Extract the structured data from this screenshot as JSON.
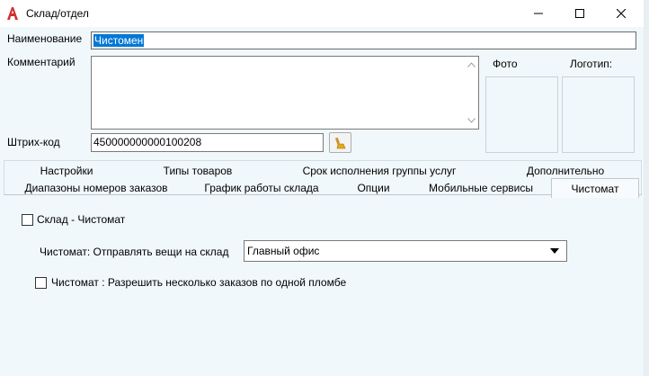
{
  "window": {
    "title": "Склад/отдел",
    "app_icon": "red-a-icon",
    "controls": [
      "minimize-icon",
      "maximize-icon",
      "close-icon"
    ]
  },
  "form": {
    "name_label": "Наименование",
    "name_value": "Чистомен",
    "comment_label": "Комментарий",
    "comment_value": "",
    "barcode_label": "Штрих-код",
    "barcode_value": "450000000000100208",
    "barcode_button_icon": "brush-icon",
    "photo_label": "Фото",
    "logo_label": "Логотип:"
  },
  "tabs": {
    "row1": [
      "Настройки",
      "Типы товаров",
      "Срок исполнения группы услуг",
      "Дополнительно"
    ],
    "row2": [
      "Диапазоны номеров заказов",
      "График работы склада",
      "Опции",
      "Мобильные сервисы",
      "Чистомат"
    ],
    "active": "Чистомат"
  },
  "panel": {
    "checkbox_warehouse_label": "Склад - Чистомат",
    "checkbox_warehouse_checked": false,
    "send_label": "Чистомат: Отправлять вещи на склад",
    "send_value": "Главный офис",
    "checkbox_multi_label": "Чистомат : Разрешить несколько заказов по одной пломбе",
    "checkbox_multi_checked": false
  },
  "colors": {
    "background": "#f0f8fc",
    "selection": "#0078d7",
    "app_icon_red": "#d32f2f"
  }
}
